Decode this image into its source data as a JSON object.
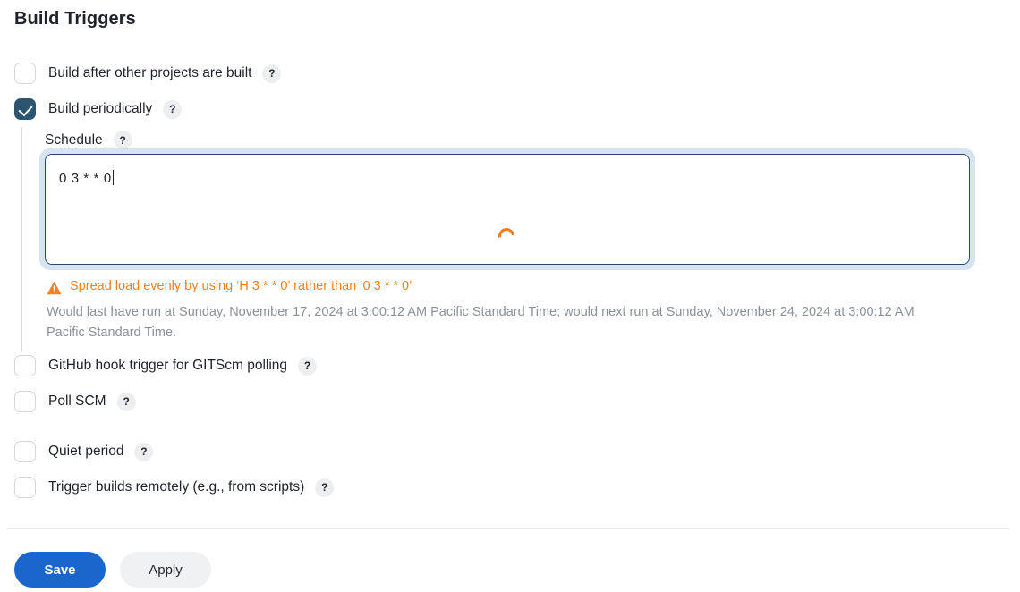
{
  "page": {
    "title": "Build Triggers"
  },
  "triggers": [
    {
      "label": "Build after other projects are built",
      "checked": false,
      "help": "?"
    },
    {
      "label": "Build periodically",
      "checked": true,
      "help": "?"
    },
    {
      "label": "GitHub hook trigger for GITScm polling",
      "checked": false,
      "help": "?"
    },
    {
      "label": "Poll SCM",
      "checked": false,
      "help": "?"
    },
    {
      "label": "Quiet period",
      "checked": false,
      "help": "?"
    },
    {
      "label": "Trigger builds remotely (e.g., from scripts)",
      "checked": false,
      "help": "?"
    }
  ],
  "schedule": {
    "label": "Schedule",
    "help": "?",
    "value": "0 3 * * 0",
    "spinner_icon": "loading-spinner-icon",
    "warning": {
      "icon": "warning-triangle-icon",
      "text": "Spread load evenly by using ‘H 3 * * 0’ rather than ‘0 3 * * 0’",
      "color": "#f2821f"
    },
    "description": "Would last have run at Sunday, November 17, 2024 at 3:00:12 AM Pacific Standard Time; would next run at Sunday, November 24, 2024 at 3:00:12 AM Pacific Standard Time."
  },
  "footer": {
    "save_label": "Save",
    "apply_label": "Apply",
    "save_color": "#1a66cc"
  }
}
